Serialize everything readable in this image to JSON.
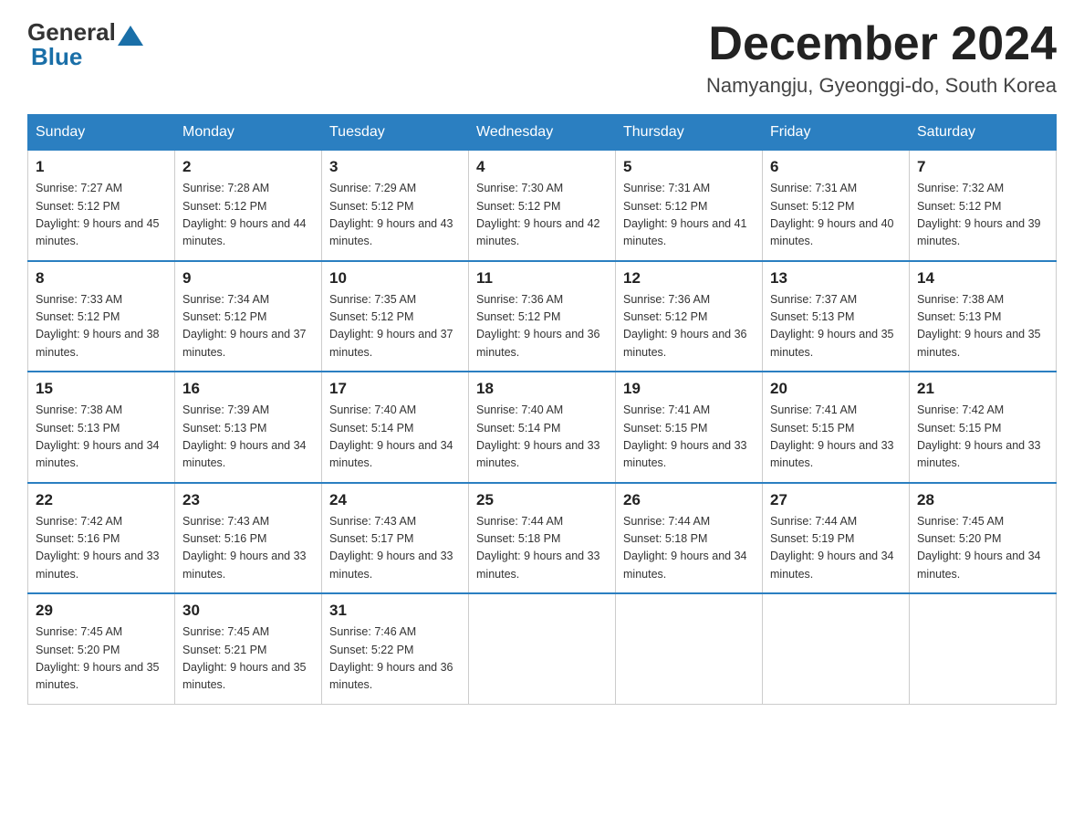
{
  "header": {
    "logo": {
      "part1": "General",
      "part2": "Blue"
    },
    "title": "December 2024",
    "location": "Namyangju, Gyeonggi-do, South Korea"
  },
  "days_of_week": [
    "Sunday",
    "Monday",
    "Tuesday",
    "Wednesday",
    "Thursday",
    "Friday",
    "Saturday"
  ],
  "weeks": [
    [
      {
        "day": "1",
        "sunrise": "7:27 AM",
        "sunset": "5:12 PM",
        "daylight": "9 hours and 45 minutes."
      },
      {
        "day": "2",
        "sunrise": "7:28 AM",
        "sunset": "5:12 PM",
        "daylight": "9 hours and 44 minutes."
      },
      {
        "day": "3",
        "sunrise": "7:29 AM",
        "sunset": "5:12 PM",
        "daylight": "9 hours and 43 minutes."
      },
      {
        "day": "4",
        "sunrise": "7:30 AM",
        "sunset": "5:12 PM",
        "daylight": "9 hours and 42 minutes."
      },
      {
        "day": "5",
        "sunrise": "7:31 AM",
        "sunset": "5:12 PM",
        "daylight": "9 hours and 41 minutes."
      },
      {
        "day": "6",
        "sunrise": "7:31 AM",
        "sunset": "5:12 PM",
        "daylight": "9 hours and 40 minutes."
      },
      {
        "day": "7",
        "sunrise": "7:32 AM",
        "sunset": "5:12 PM",
        "daylight": "9 hours and 39 minutes."
      }
    ],
    [
      {
        "day": "8",
        "sunrise": "7:33 AM",
        "sunset": "5:12 PM",
        "daylight": "9 hours and 38 minutes."
      },
      {
        "day": "9",
        "sunrise": "7:34 AM",
        "sunset": "5:12 PM",
        "daylight": "9 hours and 37 minutes."
      },
      {
        "day": "10",
        "sunrise": "7:35 AM",
        "sunset": "5:12 PM",
        "daylight": "9 hours and 37 minutes."
      },
      {
        "day": "11",
        "sunrise": "7:36 AM",
        "sunset": "5:12 PM",
        "daylight": "9 hours and 36 minutes."
      },
      {
        "day": "12",
        "sunrise": "7:36 AM",
        "sunset": "5:12 PM",
        "daylight": "9 hours and 36 minutes."
      },
      {
        "day": "13",
        "sunrise": "7:37 AM",
        "sunset": "5:13 PM",
        "daylight": "9 hours and 35 minutes."
      },
      {
        "day": "14",
        "sunrise": "7:38 AM",
        "sunset": "5:13 PM",
        "daylight": "9 hours and 35 minutes."
      }
    ],
    [
      {
        "day": "15",
        "sunrise": "7:38 AM",
        "sunset": "5:13 PM",
        "daylight": "9 hours and 34 minutes."
      },
      {
        "day": "16",
        "sunrise": "7:39 AM",
        "sunset": "5:13 PM",
        "daylight": "9 hours and 34 minutes."
      },
      {
        "day": "17",
        "sunrise": "7:40 AM",
        "sunset": "5:14 PM",
        "daylight": "9 hours and 34 minutes."
      },
      {
        "day": "18",
        "sunrise": "7:40 AM",
        "sunset": "5:14 PM",
        "daylight": "9 hours and 33 minutes."
      },
      {
        "day": "19",
        "sunrise": "7:41 AM",
        "sunset": "5:15 PM",
        "daylight": "9 hours and 33 minutes."
      },
      {
        "day": "20",
        "sunrise": "7:41 AM",
        "sunset": "5:15 PM",
        "daylight": "9 hours and 33 minutes."
      },
      {
        "day": "21",
        "sunrise": "7:42 AM",
        "sunset": "5:15 PM",
        "daylight": "9 hours and 33 minutes."
      }
    ],
    [
      {
        "day": "22",
        "sunrise": "7:42 AM",
        "sunset": "5:16 PM",
        "daylight": "9 hours and 33 minutes."
      },
      {
        "day": "23",
        "sunrise": "7:43 AM",
        "sunset": "5:16 PM",
        "daylight": "9 hours and 33 minutes."
      },
      {
        "day": "24",
        "sunrise": "7:43 AM",
        "sunset": "5:17 PM",
        "daylight": "9 hours and 33 minutes."
      },
      {
        "day": "25",
        "sunrise": "7:44 AM",
        "sunset": "5:18 PM",
        "daylight": "9 hours and 33 minutes."
      },
      {
        "day": "26",
        "sunrise": "7:44 AM",
        "sunset": "5:18 PM",
        "daylight": "9 hours and 34 minutes."
      },
      {
        "day": "27",
        "sunrise": "7:44 AM",
        "sunset": "5:19 PM",
        "daylight": "9 hours and 34 minutes."
      },
      {
        "day": "28",
        "sunrise": "7:45 AM",
        "sunset": "5:20 PM",
        "daylight": "9 hours and 34 minutes."
      }
    ],
    [
      {
        "day": "29",
        "sunrise": "7:45 AM",
        "sunset": "5:20 PM",
        "daylight": "9 hours and 35 minutes."
      },
      {
        "day": "30",
        "sunrise": "7:45 AM",
        "sunset": "5:21 PM",
        "daylight": "9 hours and 35 minutes."
      },
      {
        "day": "31",
        "sunrise": "7:46 AM",
        "sunset": "5:22 PM",
        "daylight": "9 hours and 36 minutes."
      },
      null,
      null,
      null,
      null
    ]
  ]
}
